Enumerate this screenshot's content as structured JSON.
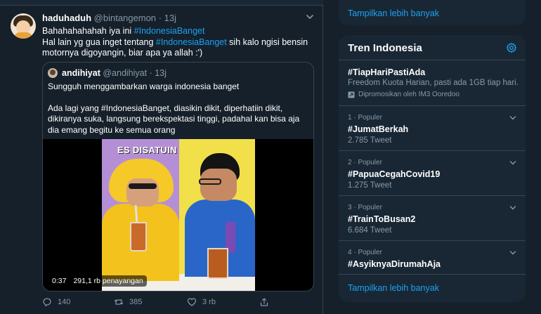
{
  "tweet": {
    "name": "haduhaduh",
    "handle": "@bintangemon",
    "dot": "·",
    "time": "13j",
    "text_line1": "Bahahahahahah iya ini ",
    "text_line1_hashtag": "#IndonesiaBanget",
    "text_line2_prefix": "Hal lain yg gua inget tentang ",
    "text_line2_hashtag": "#IndonesiaBanget",
    "text_line2_suffix": " sih kalo ngisi bensin motornya digoyangin, biar apa ya allah :')",
    "quote": {
      "name": "andihiyat",
      "handle": "@andihiyat",
      "dot": "·",
      "time": "13j",
      "text1": "Sungguh menggambarkan warga indonesia banget",
      "text2": "Ada lagi yang #IndonesiaBanget, diasikin dikit, diperhatiin dikit, dikiranya suka, langsung berekspektasi tinggi, padahal kan bisa aja dia emang begitu ke semua orang",
      "video": {
        "caption": "ES DISATUIN",
        "duration": "0:37",
        "views": "291,1 rb penayangan"
      }
    },
    "actions": {
      "replies": "140",
      "retweets": "385",
      "likes": "3 rb"
    }
  },
  "sidebar": {
    "show_more_top": "Tampilkan lebih banyak",
    "trends_title": "Tren Indonesia",
    "promoted": {
      "tag": "#TiapHariPastiAda",
      "description": "Freedom Kuota Harian, pasti ada 1GB tiap hari.",
      "by": "Dipromosikan oleh IM3 Ooredoo"
    },
    "trends": [
      {
        "meta": "1 · Populer",
        "tag": "#JumatBerkah",
        "count": "2.785 Tweet"
      },
      {
        "meta": "2 · Populer",
        "tag": "#PapuaCegahCovid19",
        "count": "1.275 Tweet"
      },
      {
        "meta": "3 · Populer",
        "tag": "#TrainToBusan2",
        "count": "6.684 Tweet"
      },
      {
        "meta": "4 · Populer",
        "tag": "#AsyiknyaDirumahAja",
        "count": ""
      }
    ],
    "show_more_bottom": "Tampilkan lebih banyak"
  },
  "colors": {
    "background": "#15202b",
    "card": "#192734",
    "accent": "#1da1f2",
    "muted": "#8899a6",
    "border": "#38444d"
  }
}
